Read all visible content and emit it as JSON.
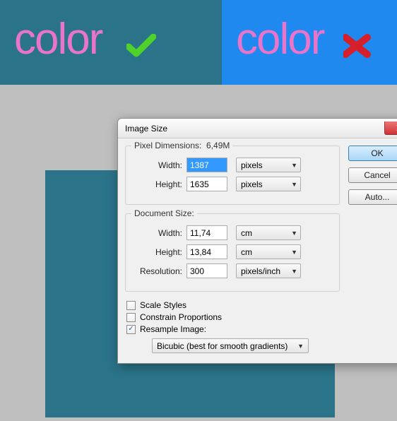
{
  "banner": {
    "left_text": "color",
    "right_text": "color"
  },
  "dialog": {
    "title": "Image Size",
    "pixel_dimensions": {
      "legend_prefix": "Pixel Dimensions:",
      "size": "6,49M",
      "width_label": "Width:",
      "width_value": "1387",
      "width_unit": "pixels",
      "height_label": "Height:",
      "height_value": "1635",
      "height_unit": "pixels"
    },
    "document_size": {
      "legend": "Document Size:",
      "width_label": "Width:",
      "width_value": "11,74",
      "width_unit": "cm",
      "height_label": "Height:",
      "height_value": "13,84",
      "height_unit": "cm",
      "resolution_label": "Resolution:",
      "resolution_value": "300",
      "resolution_unit": "pixels/inch"
    },
    "checks": {
      "scale_styles": {
        "label": "Scale Styles",
        "checked": false
      },
      "constrain": {
        "label": "Constrain Proportions",
        "checked": false
      },
      "resample": {
        "label": "Resample Image:",
        "checked": true
      }
    },
    "resample_method": "Bicubic (best for smooth gradients)",
    "buttons": {
      "ok": "OK",
      "cancel": "Cancel",
      "auto": "Auto..."
    }
  }
}
